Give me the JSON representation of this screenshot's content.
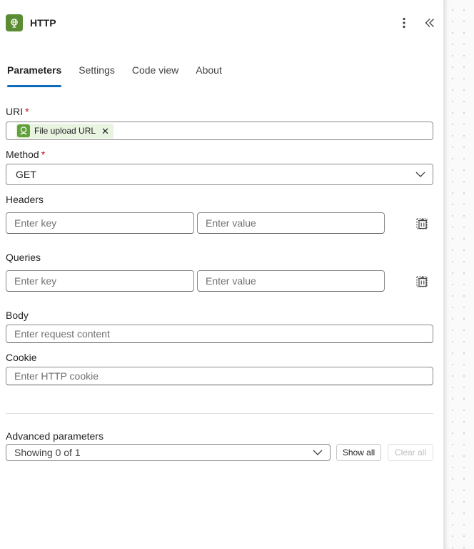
{
  "header": {
    "title": "HTTP",
    "icon": "globe-icon"
  },
  "tabs": [
    {
      "label": "Parameters",
      "active": true
    },
    {
      "label": "Settings",
      "active": false
    },
    {
      "label": "Code view",
      "active": false
    },
    {
      "label": "About",
      "active": false
    }
  ],
  "uri": {
    "label": "URI",
    "required_mark": "*",
    "token_label": "File upload URL"
  },
  "method": {
    "label": "Method",
    "required_mark": "*",
    "value": "GET"
  },
  "headers": {
    "label": "Headers",
    "key_placeholder": "Enter key",
    "value_placeholder": "Enter value"
  },
  "queries": {
    "label": "Queries",
    "key_placeholder": "Enter key",
    "value_placeholder": "Enter value"
  },
  "body": {
    "label": "Body",
    "placeholder": "Enter request content"
  },
  "cookie": {
    "label": "Cookie",
    "placeholder": "Enter HTTP cookie"
  },
  "advanced": {
    "label": "Advanced parameters",
    "selected": "Showing 0 of 1",
    "show_all_label": "Show all",
    "clear_all_label": "Clear all"
  },
  "colors": {
    "accent": "#0f6cbd",
    "brand_green": "#5b8c32",
    "required": "#c50f1f",
    "token_bg": "#e8f3e0"
  }
}
